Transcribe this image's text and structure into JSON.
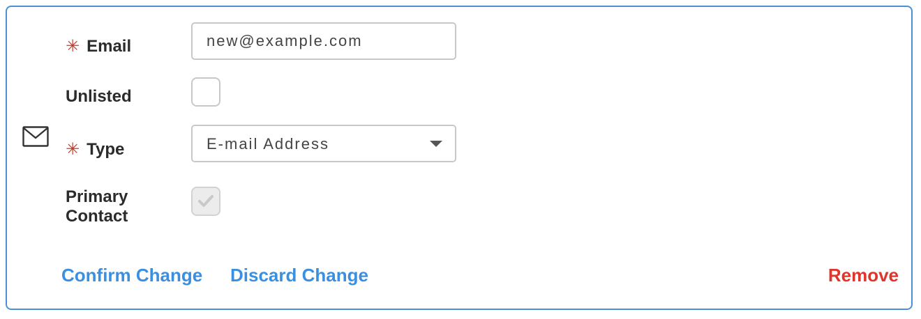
{
  "form": {
    "email_label": "Email",
    "email_value": "new@example.com",
    "unlisted_label": "Unlisted",
    "unlisted_checked": false,
    "type_label": "Type",
    "type_value": "E-mail Address",
    "primary_label_line1": "Primary",
    "primary_label_line2": "Contact",
    "primary_checked": true,
    "primary_disabled": true,
    "required_marker": "✳"
  },
  "actions": {
    "confirm_label": "Confirm Change",
    "discard_label": "Discard Change",
    "remove_label": "Remove"
  },
  "icons": {
    "row_icon": "mail-icon",
    "select_icon": "caret-down-icon",
    "check_icon": "check-icon"
  },
  "colors": {
    "border": "#4a90d9",
    "link": "#3b8fe0",
    "danger": "#e0352b",
    "required": "#c0392b"
  }
}
